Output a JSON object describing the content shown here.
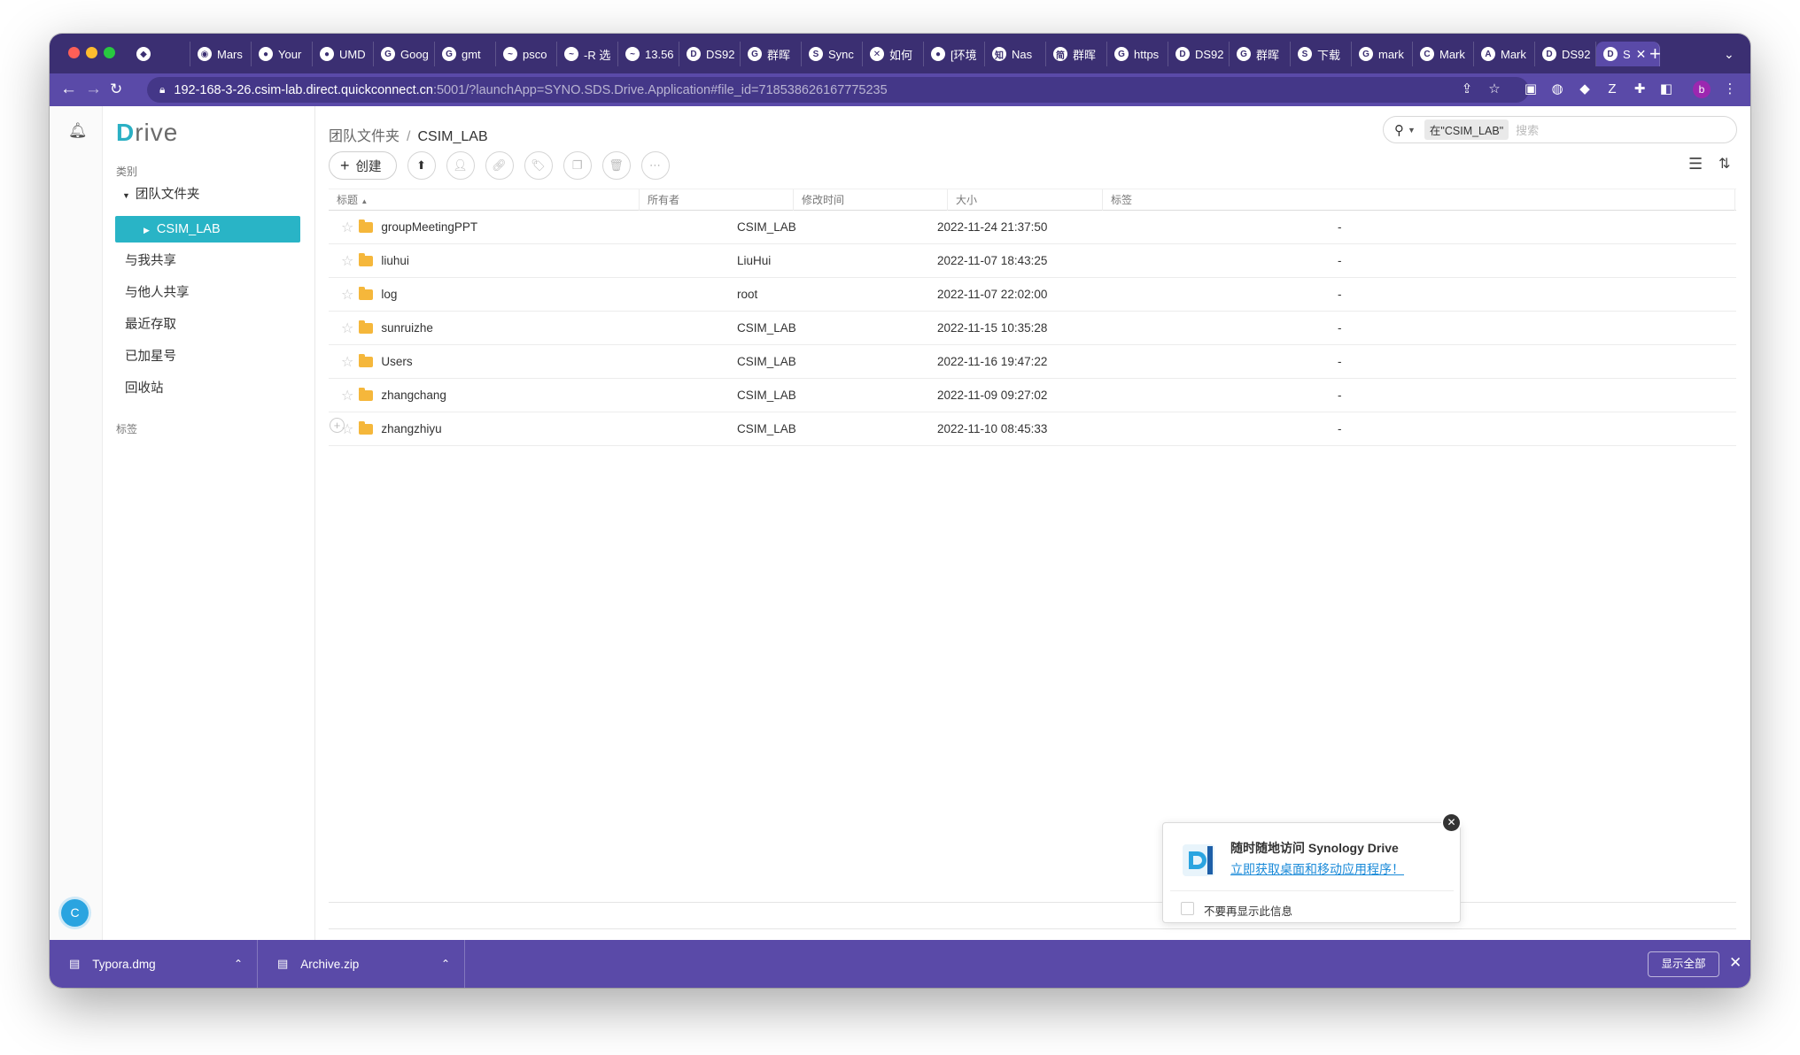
{
  "browser": {
    "tabs": [
      {
        "icon": "diamond-icon",
        "glyph": "◆",
        "label": ""
      },
      {
        "icon": "safari-icon",
        "glyph": "◉",
        "label": "Mars"
      },
      {
        "icon": "github-icon",
        "glyph": "●",
        "label": "Your"
      },
      {
        "icon": "github-icon",
        "glyph": "●",
        "label": "UMD"
      },
      {
        "icon": "google-translate-icon",
        "glyph": "G",
        "label": "Goog"
      },
      {
        "icon": "google-icon",
        "glyph": "G",
        "label": "gmt"
      },
      {
        "icon": "wave-icon",
        "glyph": "~",
        "label": "psco"
      },
      {
        "icon": "wave-icon",
        "glyph": "~",
        "label": "-R 选"
      },
      {
        "icon": "wave-icon",
        "glyph": "~",
        "label": "13.56"
      },
      {
        "icon": "dsm-icon",
        "glyph": "D",
        "label": "DS92"
      },
      {
        "icon": "google-icon",
        "glyph": "G",
        "label": "群晖"
      },
      {
        "icon": "s-icon",
        "glyph": "S",
        "label": "Sync"
      },
      {
        "icon": "x-icon",
        "glyph": "✕",
        "label": "如何"
      },
      {
        "icon": "circle-icon",
        "glyph": "●",
        "label": "[环境"
      },
      {
        "icon": "zhihu-icon",
        "glyph": "知",
        "label": "Nas"
      },
      {
        "icon": "red-icon",
        "glyph": "简",
        "label": "群晖"
      },
      {
        "icon": "google-icon",
        "glyph": "G",
        "label": "https"
      },
      {
        "icon": "dsm-icon",
        "glyph": "D",
        "label": "DS92"
      },
      {
        "icon": "google-icon",
        "glyph": "G",
        "label": "群晖"
      },
      {
        "icon": "s-icon",
        "glyph": "S",
        "label": "下载"
      },
      {
        "icon": "google-icon",
        "glyph": "G",
        "label": "mark"
      },
      {
        "icon": "c-icon",
        "glyph": "C",
        "label": "Mark"
      },
      {
        "icon": "a-icon",
        "glyph": "A",
        "label": "Mark"
      },
      {
        "icon": "dsm-icon",
        "glyph": "D",
        "label": "DS92"
      },
      {
        "icon": "synology-drive-icon",
        "glyph": "D",
        "label": "S",
        "active": true
      }
    ],
    "url_host": "192-168-3-26.csim-lab.direct.quickconnect.cn",
    "url_path": ":5001/?launchApp=SYNO.SDS.Drive.Application#file_id=718538626167775235",
    "profile_initial": "b"
  },
  "sidebar": {
    "category_label": "类别",
    "team_folder": "团队文件夹",
    "selected": "CSIM_LAB",
    "items": [
      "与我共享",
      "与他人共享",
      "最近存取",
      "已加星号",
      "回收站"
    ],
    "tags_label": "标签",
    "user_initial": "C"
  },
  "main": {
    "breadcrumb": [
      "团队文件夹",
      "CSIM_LAB"
    ],
    "search": {
      "scope": "在\"CSIM_LAB\"",
      "placeholder": "搜索"
    },
    "create_label": "创建",
    "columns": [
      "标题",
      "所有者",
      "修改时间",
      "大小",
      "标签"
    ],
    "rows": [
      {
        "name": "groupMeetingPPT",
        "owner": "CSIM_LAB",
        "modified": "2022-11-24 21:37:50",
        "size": "",
        "tags": "-"
      },
      {
        "name": "liuhui",
        "owner": "LiuHui",
        "modified": "2022-11-07 18:43:25",
        "size": "",
        "tags": "-"
      },
      {
        "name": "log",
        "owner": "root",
        "modified": "2022-11-07 22:02:00",
        "size": "",
        "tags": "-"
      },
      {
        "name": "sunruizhe",
        "owner": "CSIM_LAB",
        "modified": "2022-11-15 10:35:28",
        "size": "",
        "tags": "-"
      },
      {
        "name": "Users",
        "owner": "CSIM_LAB",
        "modified": "2022-11-16 19:47:22",
        "size": "",
        "tags": "-"
      },
      {
        "name": "zhangchang",
        "owner": "CSIM_LAB",
        "modified": "2022-11-09 09:27:02",
        "size": "",
        "tags": "-"
      },
      {
        "name": "zhangzhiyu",
        "owner": "CSIM_LAB",
        "modified": "2022-11-10 08:45:33",
        "size": "",
        "tags": "-"
      }
    ]
  },
  "popup": {
    "title": "随时随地访问 Synology Drive",
    "link": "立即获取桌面和移动应用程序！",
    "checkbox_label": "不要再显示此信息"
  },
  "downloads": {
    "items": [
      "Typora.dmg",
      "Archive.zip"
    ],
    "show_all": "显示全部"
  },
  "colors": {
    "browser_frame": "#3b2f72",
    "toolbar": "#5a4aa8",
    "accent": "#29b4c6",
    "folder": "#f5b73b",
    "link": "#1a8ad8"
  }
}
